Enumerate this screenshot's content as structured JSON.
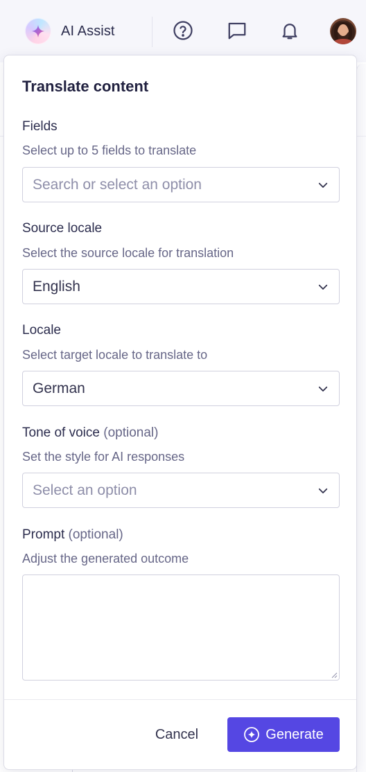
{
  "topbar": {
    "ai_assist_label": "AI Assist",
    "icons": [
      "help-circle-icon",
      "chat-icon",
      "bell-icon"
    ],
    "avatar": "user-avatar"
  },
  "panel": {
    "title": "Translate content",
    "fields": {
      "label": "Fields",
      "help": "Select up to 5 fields to translate",
      "placeholder": "Search or select an option"
    },
    "source_locale": {
      "label": "Source locale",
      "help": "Select the source locale for translation",
      "value": "English"
    },
    "locale": {
      "label": "Locale",
      "help": "Select target locale to translate to",
      "value": "German"
    },
    "tone": {
      "label": "Tone of voice",
      "optional": "(optional)",
      "help": "Set the style for AI responses",
      "placeholder": "Select an option"
    },
    "prompt": {
      "label": "Prompt",
      "optional": "(optional)",
      "help": "Adjust the generated outcome",
      "value": ""
    },
    "footer": {
      "cancel_label": "Cancel",
      "generate_label": "Generate"
    }
  },
  "colors": {
    "accent": "#5547e3",
    "text": "#32324d",
    "muted": "#666687",
    "border": "#d0d0de"
  }
}
